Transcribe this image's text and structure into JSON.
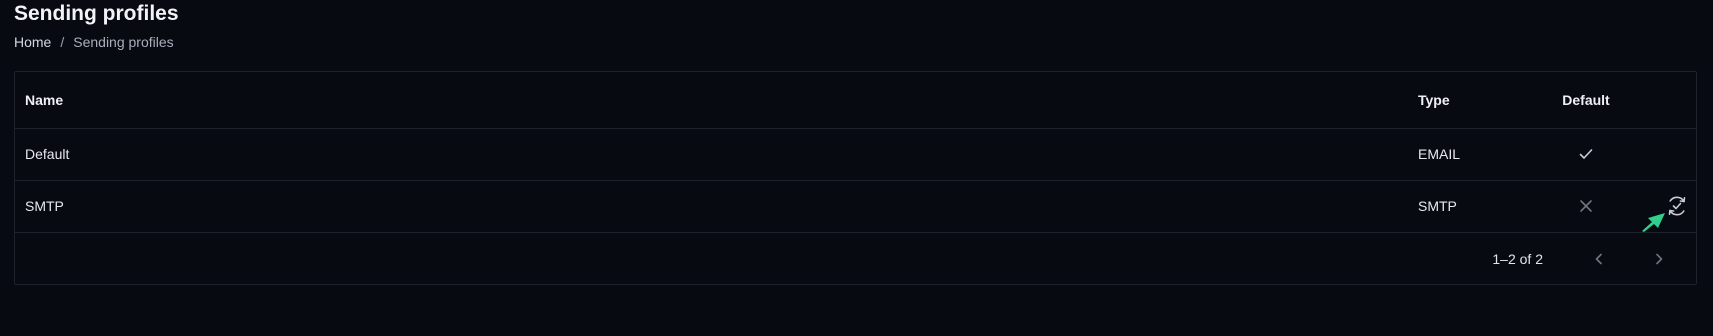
{
  "page": {
    "title": "Sending profiles"
  },
  "breadcrumb": {
    "home": "Home",
    "separator": "/",
    "current": "Sending profiles"
  },
  "table": {
    "columns": {
      "name": "Name",
      "type": "Type",
      "default": "Default"
    },
    "rows": [
      {
        "name": "Default",
        "type": "EMAIL",
        "default": "check-icon",
        "action": null
      },
      {
        "name": "SMTP",
        "type": "SMTP",
        "default": "close-icon",
        "action": "set-default-icon"
      }
    ]
  },
  "pagination": {
    "range": "1–2 of 2",
    "prev_icon": "chevron-left-icon",
    "next_icon": "chevron-right-icon"
  },
  "colors": {
    "background": "#070a11",
    "border": "#1d222d",
    "text": "#e8eaf0",
    "muted": "#7d8290",
    "cursor": "#2fcf8c"
  }
}
